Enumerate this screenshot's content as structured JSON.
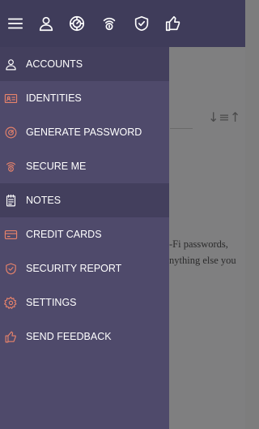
{
  "colors": {
    "toolbar_bg": "#3f3c5a",
    "drawer_bg": "#4f4a6b",
    "active_item_bg": "#433f5d",
    "icon_accent": "#e8836b",
    "overlay": "#7f7f80"
  },
  "toolbar": {
    "icons": [
      "menu-icon",
      "user-icon",
      "dial-icon",
      "shield-signal-icon",
      "shield-check-icon",
      "thumbs-up-icon"
    ]
  },
  "menu": {
    "items": [
      {
        "label": "ACCOUNTS",
        "icon": "user-icon"
      },
      {
        "label": "IDENTITIES",
        "icon": "id-card-icon"
      },
      {
        "label": "GENERATE PASSWORD",
        "icon": "dial-icon"
      },
      {
        "label": "SECURE ME",
        "icon": "shield-signal-icon"
      },
      {
        "label": "NOTES",
        "icon": "notepad-icon"
      },
      {
        "label": "CREDIT CARDS",
        "icon": "credit-card-icon"
      },
      {
        "label": "SECURITY REPORT",
        "icon": "shield-check-icon"
      },
      {
        "label": "SETTINGS",
        "icon": "gear-icon"
      },
      {
        "label": "SEND FEEDBACK",
        "icon": "thumbs-up-icon"
      }
    ]
  },
  "background": {
    "sort_label": "↓≡↑",
    "text_line_1": "-Fi passwords,",
    "text_line_2": "nything else you"
  }
}
